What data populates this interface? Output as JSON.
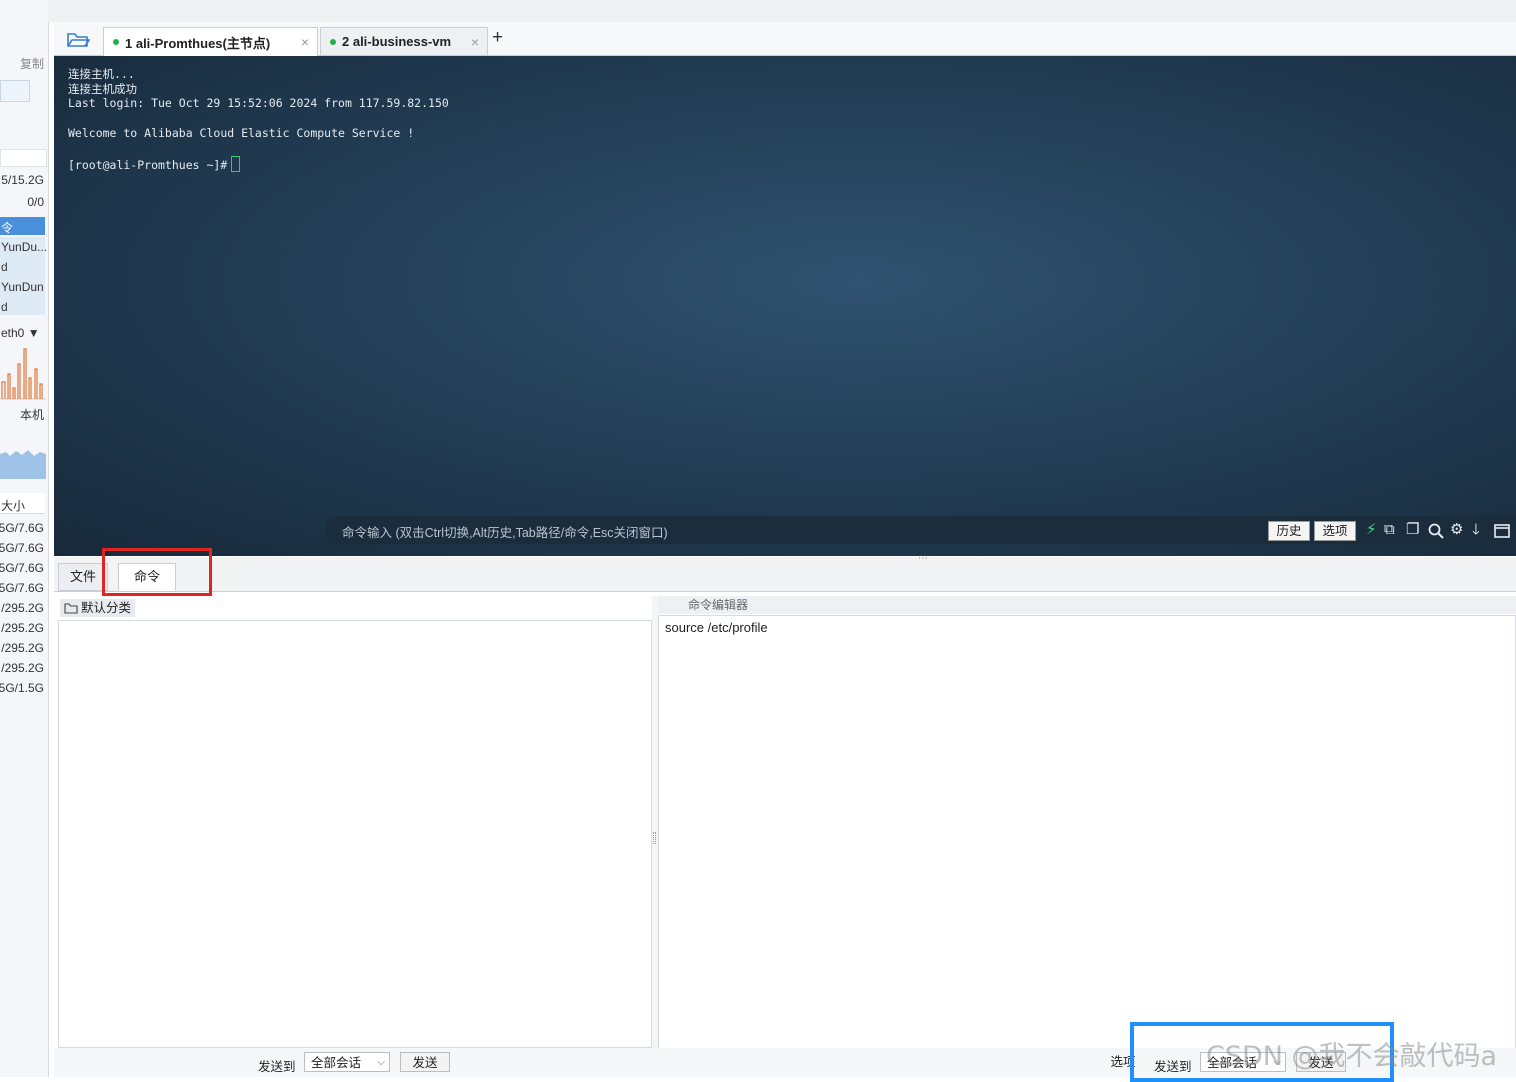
{
  "sidebar": {
    "copy_label": "复制",
    "mem_value": "5/15.2G",
    "swap_value": "0/0",
    "process_header": "令",
    "process_rows": [
      "YunDu...",
      "d",
      "YunDun",
      "d"
    ],
    "net_iface": "eth0",
    "local_label": "本机",
    "disk_header": "大小",
    "disk_rows": [
      "5G/7.6G",
      "5G/7.6G",
      "5G/7.6G",
      "5G/7.6G",
      "/295.2G",
      "/295.2G",
      "/295.2G",
      "/295.2G",
      "5G/1.5G"
    ]
  },
  "tabs": [
    {
      "label": "1 ali-Promthues(主节点)",
      "active": true
    },
    {
      "label": "2 ali-business-vm",
      "active": false
    }
  ],
  "add_tab_label": "+",
  "terminal": {
    "lines": [
      "连接主机...",
      "连接主机成功",
      "Last login: Tue Oct 29 15:52:06 2024 from 117.59.82.150",
      "",
      "Welcome to Alibaba Cloud Elastic Compute Service !",
      "",
      "[root@ali-Promthues ~]#"
    ],
    "cmd_hint": "命令输入 (双击Ctrl切换,Alt历史,Tab路径/命令,Esc关闭窗口)",
    "history_btn": "历史",
    "options_btn": "选项"
  },
  "panel_tabs": [
    {
      "label": "文件",
      "active": false
    },
    {
      "label": "命令",
      "active": true
    }
  ],
  "command_panel": {
    "category": "默认分类",
    "editor_title": "命令编辑器",
    "editor_content": "source /etc/profile"
  },
  "bottom_left": {
    "send_to_label": "发送到",
    "target": "全部会话",
    "send_btn": "发送"
  },
  "bottom_right": {
    "options_label": "选项",
    "send_to_label": "发送到",
    "target": "全部会话",
    "send_btn": "发送"
  },
  "watermark": "CSDN @我不会敲代码a",
  "colors": {
    "highlight_red": "#e0261c",
    "highlight_blue": "#1e90ff",
    "status_green": "#22b14c"
  }
}
